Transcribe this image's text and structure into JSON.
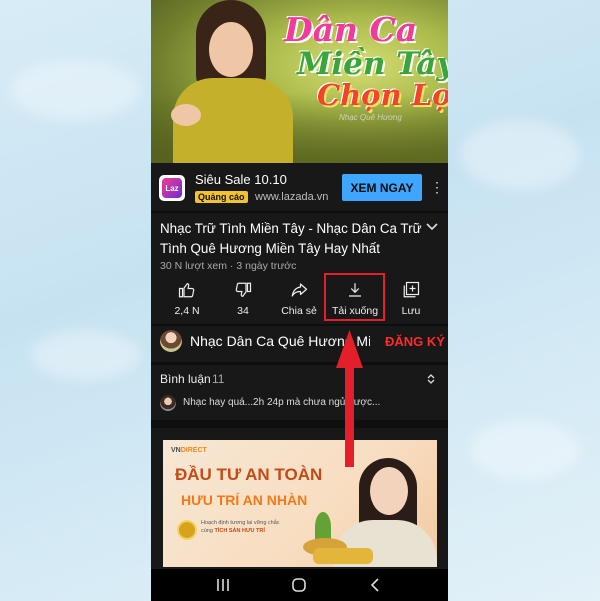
{
  "colors": {
    "accent_blue": "#3ea6ff",
    "subscribe_red": "#ff2b2b",
    "highlight_red": "#e3202a",
    "badge_yellow": "#f2c230",
    "app_bg": "#181818"
  },
  "thumbnail": {
    "line1": "Dân Ca",
    "line2": "Miền Tây",
    "line3": "Chọn Lọc",
    "subline": "Nhạc Quê Hương"
  },
  "ad": {
    "logo_text": "Laz",
    "title": "Siêu Sale 10.10",
    "badge": "Quảng cáo",
    "url": "www.lazada.vn",
    "cta": "XEM NGAY",
    "menu_icon": "more-vert-icon"
  },
  "video": {
    "title": "Nhạc Trữ Tình Miền Tây - Nhạc Dân Ca Trữ Tình Quê Hương Miền Tây Hay Nhất",
    "meta": "30 N lượt xem · 3 ngày trước"
  },
  "actions": [
    {
      "icon": "thumbs-up-icon",
      "label": "2,4 N"
    },
    {
      "icon": "thumbs-down-icon",
      "label": "34"
    },
    {
      "icon": "share-icon",
      "label": "Chia sẻ"
    },
    {
      "icon": "download-icon",
      "label": "Tải xuống"
    },
    {
      "icon": "save-playlist-icon",
      "label": "Lưu"
    }
  ],
  "channel": {
    "name": "Nhạc Dân Ca Quê Hương Miền...",
    "subscribe": "ĐĂNG KÝ"
  },
  "comments": {
    "heading": "Bình luận",
    "count": "11",
    "preview": "Nhạc hay quá...2h 24p mà chưa ngủ được..."
  },
  "banner": {
    "brand_prefix": "VN",
    "brand_suffix": "DIRECT",
    "line1": "ĐẦU TƯ AN TOÀN",
    "line2": "HƯU TRÍ AN NHÀN",
    "small1": "Hoạch định tương lai vững chắc",
    "small2_prefix": "cùng",
    "small2_bold": "TÍCH SẢN HƯU TRÍ"
  },
  "navbar": [
    "recent-apps-icon",
    "home-icon",
    "back-icon"
  ]
}
